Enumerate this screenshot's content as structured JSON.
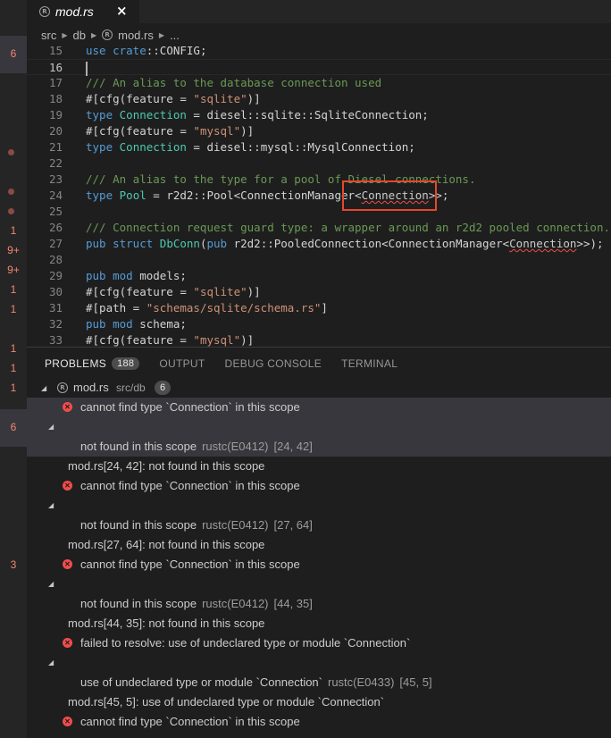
{
  "tab": {
    "label": "mod.rs",
    "close": "×",
    "icon": "rust-file-icon"
  },
  "breadcrumb": [
    "src",
    "db",
    "mod.rs",
    "..."
  ],
  "gutter_badges": [
    "6",
    "1",
    "9+",
    "9+",
    "1",
    "1",
    "1",
    "1",
    "1",
    "6",
    "3"
  ],
  "code_lines": [
    {
      "num": "15",
      "tokens": [
        [
          "kw",
          "use "
        ],
        [
          "kw",
          "crate"
        ],
        [
          "df",
          "::CONFIG;"
        ]
      ]
    },
    {
      "num": "16",
      "tokens": [],
      "current": true
    },
    {
      "num": "17",
      "tokens": [
        [
          "cm",
          "/// An alias to the database connection used"
        ]
      ]
    },
    {
      "num": "18",
      "tokens": [
        [
          "df",
          "#[cfg(feature = "
        ],
        [
          "st",
          "\"sqlite\""
        ],
        [
          "df",
          ")]"
        ]
      ]
    },
    {
      "num": "19",
      "tokens": [
        [
          "kw",
          "type "
        ],
        [
          "ty",
          "Connection"
        ],
        [
          "df",
          " = diesel::sqlite::SqliteConnection;"
        ]
      ]
    },
    {
      "num": "20",
      "tokens": [
        [
          "df",
          "#[cfg(feature = "
        ],
        [
          "st",
          "\"mysql\""
        ],
        [
          "df",
          ")]"
        ]
      ]
    },
    {
      "num": "21",
      "tokens": [
        [
          "kw",
          "type "
        ],
        [
          "ty",
          "Connection"
        ],
        [
          "df",
          " = diesel::mysql::MysqlConnection;"
        ]
      ]
    },
    {
      "num": "22",
      "tokens": []
    },
    {
      "num": "23",
      "tokens": [
        [
          "cm",
          "/// An alias to the type for a pool of Diesel connections."
        ]
      ]
    },
    {
      "num": "24",
      "tokens": [
        [
          "kw",
          "type "
        ],
        [
          "ty",
          "Pool"
        ],
        [
          "df",
          " = r2d2::Pool<ConnectionManager<"
        ],
        [
          "squig",
          "Connection"
        ],
        [
          "df",
          ">>;"
        ]
      ]
    },
    {
      "num": "25",
      "tokens": []
    },
    {
      "num": "26",
      "tokens": [
        [
          "cm",
          "/// Connection request guard type: a wrapper around an r2d2 pooled connection."
        ]
      ]
    },
    {
      "num": "27",
      "tokens": [
        [
          "kw",
          "pub struct "
        ],
        [
          "ty",
          "DbConn"
        ],
        [
          "df",
          "("
        ],
        [
          "kw",
          "pub "
        ],
        [
          "df",
          "r2d2::PooledConnection<ConnectionManager<"
        ],
        [
          "squig",
          "Connection"
        ],
        [
          "df",
          ">>);"
        ]
      ]
    },
    {
      "num": "28",
      "tokens": []
    },
    {
      "num": "29",
      "tokens": [
        [
          "kw",
          "pub mod "
        ],
        [
          "df",
          "models;"
        ]
      ]
    },
    {
      "num": "30",
      "tokens": [
        [
          "df",
          "#[cfg(feature = "
        ],
        [
          "st",
          "\"sqlite\""
        ],
        [
          "df",
          ")]"
        ]
      ]
    },
    {
      "num": "31",
      "tokens": [
        [
          "df",
          "#[path = "
        ],
        [
          "st",
          "\"schemas/sqlite/schema.rs\""
        ],
        [
          "df",
          "]"
        ]
      ]
    },
    {
      "num": "32",
      "tokens": [
        [
          "kw",
          "pub mod "
        ],
        [
          "df",
          "schema;"
        ]
      ]
    },
    {
      "num": "33",
      "tokens": [
        [
          "df",
          "#[cfg(feature = "
        ],
        [
          "st",
          "\"mysql\""
        ],
        [
          "df",
          ")]"
        ]
      ]
    }
  ],
  "panel": {
    "tabs": [
      "PROBLEMS",
      "OUTPUT",
      "DEBUG CONSOLE",
      "TERMINAL"
    ],
    "problems_count": "188",
    "file": {
      "name": "mod.rs",
      "path": "src/db",
      "count": "6"
    },
    "problems": [
      {
        "msg": "cannot find type `Connection` in this scope",
        "sub": "not found in this scope",
        "code": "rustc(E0412)",
        "pos": "[24, 42]",
        "rel": "mod.rs[24, 42]: not found in this scope"
      },
      {
        "msg": "cannot find type `Connection` in this scope",
        "sub": "not found in this scope",
        "code": "rustc(E0412)",
        "pos": "[27, 64]",
        "rel": "mod.rs[27, 64]: not found in this scope"
      },
      {
        "msg": "cannot find type `Connection` in this scope",
        "sub": "not found in this scope",
        "code": "rustc(E0412)",
        "pos": "[44, 35]",
        "rel": "mod.rs[44, 35]: not found in this scope"
      },
      {
        "msg": "failed to resolve: use of undeclared type or module `Connection`",
        "sub": "use of undeclared type or module `Connection`",
        "code": "rustc(E0433)",
        "pos": "[45, 5]",
        "rel": "mod.rs[45, 5]: use of undeclared type or module `Connection`"
      },
      {
        "msg": "cannot find type `Connection` in this scope"
      }
    ]
  },
  "colors": {
    "error": "#f14c4c",
    "highlight_box": "#e8472c",
    "background": "#1e1e1e"
  }
}
